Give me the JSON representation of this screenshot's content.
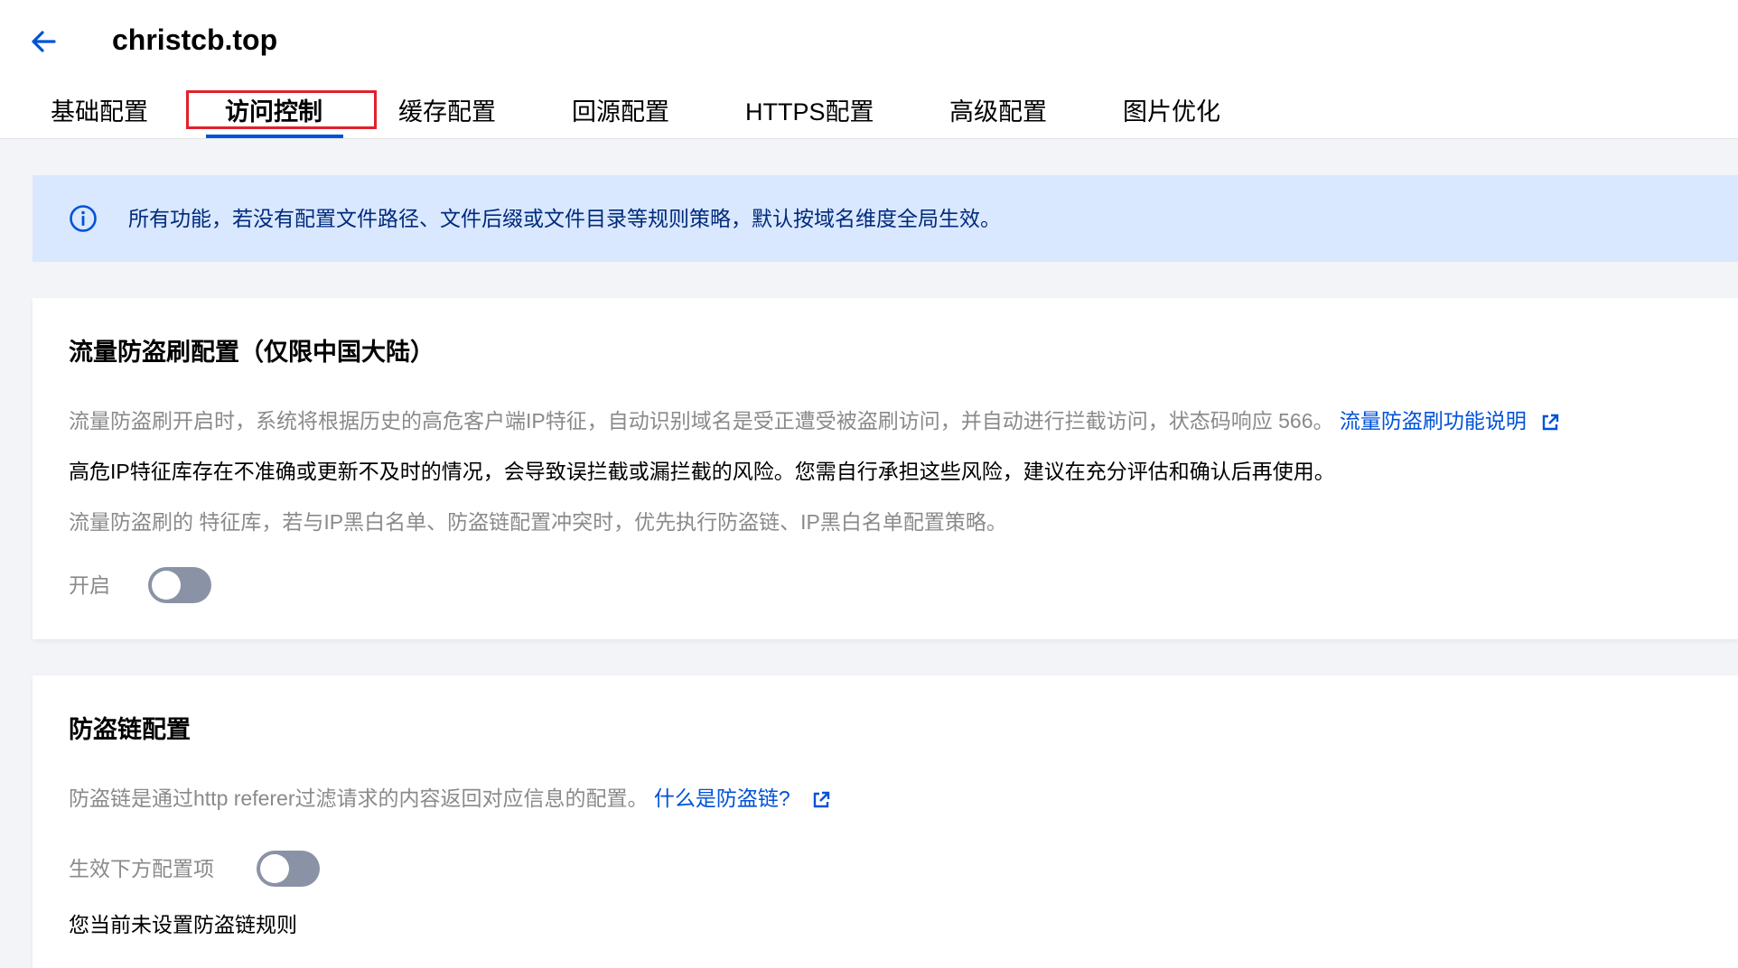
{
  "header": {
    "title": "christcb.top",
    "back_icon": "arrow-left-icon"
  },
  "tabs": [
    {
      "label": "基础配置",
      "active": false
    },
    {
      "label": "访问控制",
      "active": true
    },
    {
      "label": "缓存配置",
      "active": false
    },
    {
      "label": "回源配置",
      "active": false
    },
    {
      "label": "HTTPS配置",
      "active": false
    },
    {
      "label": "高级配置",
      "active": false
    },
    {
      "label": "图片优化",
      "active": false
    }
  ],
  "info_banner": {
    "icon": "info-circle-icon",
    "text": "所有功能，若没有配置文件路径、文件后缀或文件目录等规则策略，默认按域名维度全局生效。"
  },
  "traffic_card": {
    "title": "流量防盗刷配置（仅限中国大陆）",
    "desc1": "流量防盗刷开启时，系统将根据历史的高危客户端IP特征，自动识别域名是受正遭受被盗刷访问，并自动进行拦截访问，状态码响应 566。",
    "desc1_link": "流量防盗刷功能说明",
    "desc2": "高危IP特征库存在不准确或更新不及时的情况，会导致误拦截或漏拦截的风险。您需自行承担这些风险，建议在充分评估和确认后再使用。",
    "desc3": "流量防盗刷的 特征库，若与IP黑白名单、防盗链配置冲突时，优先执行防盗链、IP黑白名单配置策略。",
    "toggle_label": "开启",
    "toggle_on": false
  },
  "referer_card": {
    "title": "防盗链配置",
    "desc": "防盗链是通过http referer过滤请求的内容返回对应信息的配置。",
    "desc_link": "什么是防盗链?",
    "toggle_label": "生效下方配置项",
    "toggle_on": false,
    "status": "您当前未设置防盗链规则"
  },
  "colors": {
    "accent": "#0052d9",
    "banner_bg": "#d9e8fe",
    "highlight_box": "#e3202a",
    "toggle_off": "#8a93a6"
  }
}
